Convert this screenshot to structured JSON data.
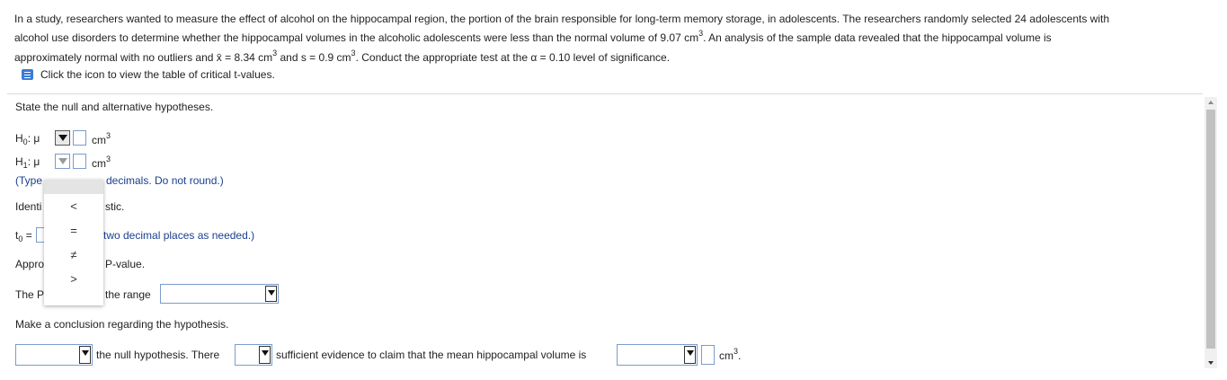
{
  "problem": {
    "line1": "In a study, researchers wanted to measure the effect of alcohol on the hippocampal region, the portion of the brain responsible for long-term memory storage, in adolescents. The researchers randomly selected 24 adolescents with",
    "line2a": "alcohol use disorders to determine whether the hippocampal volumes in the alcoholic adolescents were less than the normal volume of 9.07 cm",
    "line2b": ". An analysis of the sample data revealed that the hippocampal volume is",
    "line3a": "approximately normal with no outliers and x̄ = 8.34 cm",
    "line3b": " and s = 0.9 cm",
    "line3c": ". Conduct the appropriate test at the α = 0.10 level of significance.",
    "sup3": "3",
    "icon_text": "Click the icon to view the table of critical t-values."
  },
  "step1": {
    "instruction": "State the null and alternative hypotheses.",
    "h0_label": "H",
    "h0_sub": "0",
    "h1_label": "H",
    "h1_sub": "1",
    "mu": ": μ",
    "unit": "cm",
    "unit_sup": "3",
    "type_hint_a": "(Type",
    "type_hint_b": "decimals. Do not round.)"
  },
  "step2": {
    "identify_a": "Identi",
    "identify_b": "stic.",
    "t0_label": "t",
    "t0_sub": "0",
    "t0_eq": "=",
    "round_hint": "two decimal places as needed.)"
  },
  "step3": {
    "approx_a": "Appro",
    "approx_b": "P-value.",
    "pvalue_a": "The P",
    "pvalue_b": "the range"
  },
  "conclusion": {
    "instruction": "Make a conclusion regarding the hypothesis.",
    "text1": "the null hypothesis. There",
    "text2": "sufficient evidence to claim that the mean hippocampal volume is",
    "unit": "cm",
    "unit_sup": "3",
    "unit_period": "."
  },
  "operator_menu": {
    "options": [
      "<",
      "=",
      "≠",
      ">"
    ]
  }
}
